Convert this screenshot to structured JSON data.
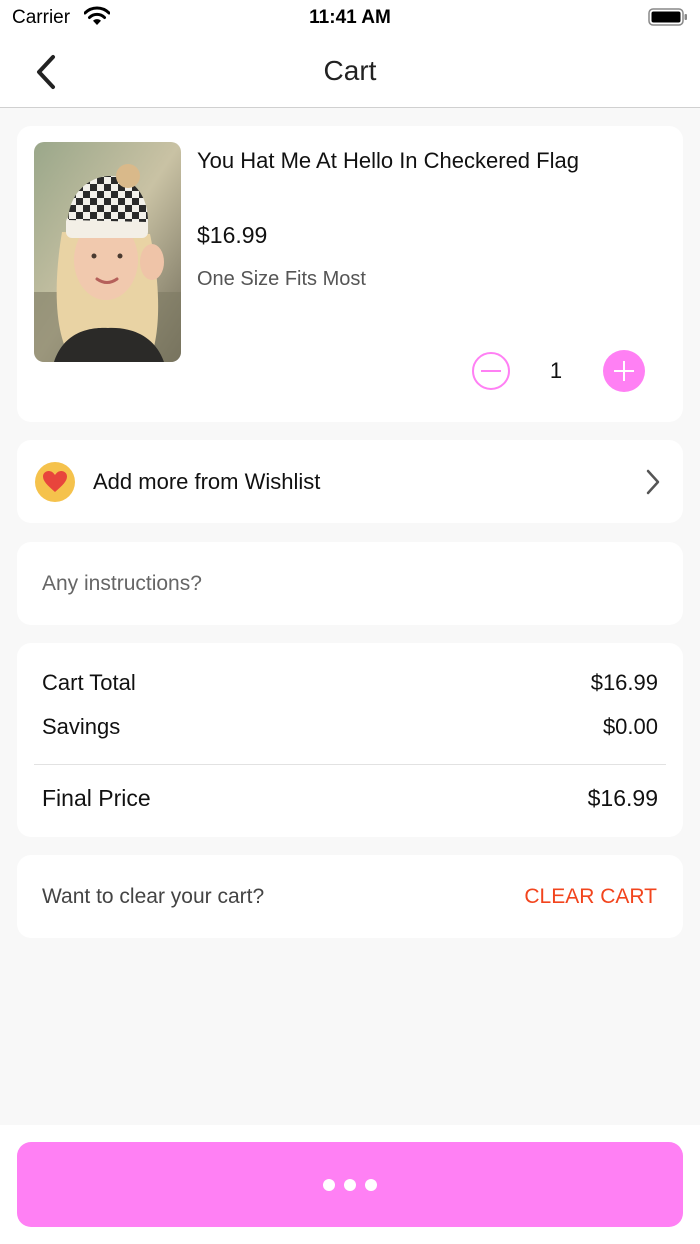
{
  "status_bar": {
    "carrier": "Carrier",
    "time": "11:41 AM"
  },
  "header": {
    "title": "Cart",
    "back_icon": "chevron-left-icon"
  },
  "cart_item": {
    "name": "You Hat Me At Hello In Checkered Flag",
    "price": "$16.99",
    "size": "One Size Fits Most",
    "quantity": "1"
  },
  "wishlist": {
    "label": "Add more from Wishlist",
    "icon": "heart-icon"
  },
  "instructions": {
    "placeholder": "Any instructions?",
    "value": ""
  },
  "totals": {
    "cart_total_label": "Cart Total",
    "cart_total_value": "$16.99",
    "savings_label": "Savings",
    "savings_value": "$0.00",
    "final_price_label": "Final Price",
    "final_price_value": "$16.99"
  },
  "clear_cart": {
    "prompt": "Want to clear your cart?",
    "button_label": "CLEAR CART"
  },
  "colors": {
    "accent": "#ff80f4",
    "danger": "#f2441d",
    "heart_badge": "#f5c24c",
    "background": "#f8f8f8"
  }
}
